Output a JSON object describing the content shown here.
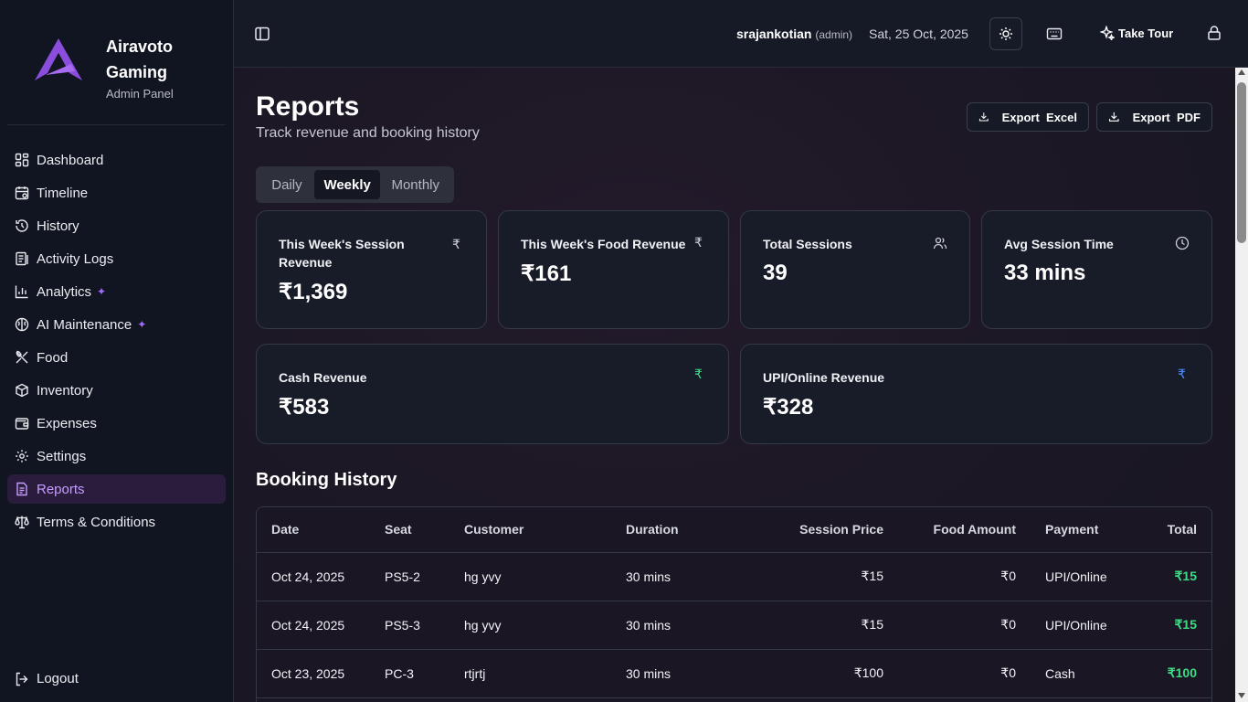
{
  "brand": {
    "name_line1": "Airavoto",
    "name_line2": "Gaming",
    "subtitle": "Admin Panel"
  },
  "sidebar": {
    "items": [
      {
        "label": "Dashboard",
        "icon": "dashboard-icon"
      },
      {
        "label": "Timeline",
        "icon": "calendar-icon"
      },
      {
        "label": "History",
        "icon": "history-icon"
      },
      {
        "label": "Activity Logs",
        "icon": "logs-icon"
      },
      {
        "label": "Analytics",
        "icon": "chart-icon",
        "badge": "sparkle"
      },
      {
        "label": "AI Maintenance",
        "icon": "brain-icon",
        "badge": "sparkle"
      },
      {
        "label": "Food",
        "icon": "utensils-icon"
      },
      {
        "label": "Inventory",
        "icon": "package-icon"
      },
      {
        "label": "Expenses",
        "icon": "wallet-icon"
      },
      {
        "label": "Settings",
        "icon": "gear-icon"
      },
      {
        "label": "Reports",
        "icon": "file-icon",
        "active": true
      },
      {
        "label": "Terms & Conditions",
        "icon": "scale-icon"
      }
    ],
    "logout": "Logout"
  },
  "topbar": {
    "username": "srajankotian",
    "role": "(admin)",
    "date": "Sat, 25 Oct, 2025",
    "tour_label": "Take Tour"
  },
  "page": {
    "title": "Reports",
    "subtitle": "Track revenue and booking history",
    "export_excel": "Export  Excel",
    "export_pdf": "Export  PDF",
    "tabs": [
      "Daily",
      "Weekly",
      "Monthly"
    ],
    "active_tab": "Weekly"
  },
  "stats": {
    "session_revenue": {
      "title": "This Week's Session Revenue",
      "value": "₹1,369"
    },
    "food_revenue": {
      "title": "This Week's Food Revenue",
      "value": "₹161"
    },
    "total_sessions": {
      "title": "Total Sessions",
      "value": "39"
    },
    "avg_session": {
      "title": "Avg Session Time",
      "value": "33 mins"
    },
    "cash_revenue": {
      "title": "Cash Revenue",
      "value": "₹583"
    },
    "upi_revenue": {
      "title": "UPI/Online Revenue",
      "value": "₹328"
    }
  },
  "colors": {
    "accent": "#c79cff",
    "green": "#3ddc84",
    "blue": "#4f8dff"
  },
  "booking_history": {
    "title": "Booking History",
    "columns": [
      "Date",
      "Seat",
      "Customer",
      "Duration",
      "Session Price",
      "Food Amount",
      "Payment",
      "Total"
    ],
    "rows": [
      {
        "date": "Oct 24, 2025",
        "seat": "PS5-2",
        "customer": "hg yvy",
        "duration": "30 mins",
        "session_price": "₹15",
        "food_amount": "₹0",
        "payment": "UPI/Online",
        "total": "₹15"
      },
      {
        "date": "Oct 24, 2025",
        "seat": "PS5-3",
        "customer": "hg yvy",
        "duration": "30 mins",
        "session_price": "₹15",
        "food_amount": "₹0",
        "payment": "UPI/Online",
        "total": "₹15"
      },
      {
        "date": "Oct 23, 2025",
        "seat": "PC-3",
        "customer": "rtjrtj",
        "duration": "30 mins",
        "session_price": "₹100",
        "food_amount": "₹0",
        "payment": "Cash",
        "total": "₹100"
      }
    ]
  }
}
